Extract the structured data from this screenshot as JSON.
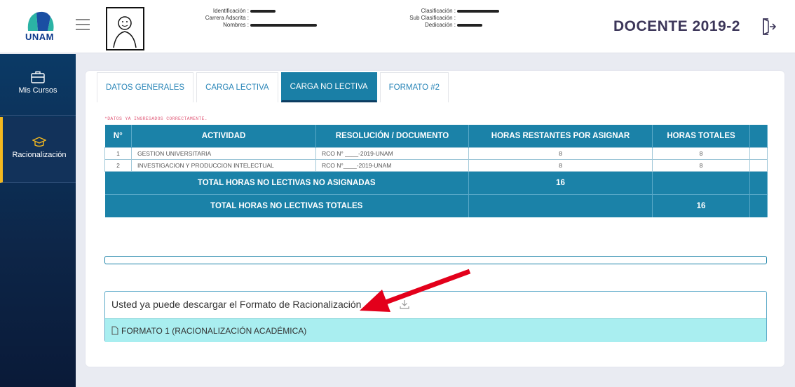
{
  "header": {
    "logo_text": "UNAM",
    "title": "DOCENTE 2019-2",
    "info_left": [
      {
        "label": "Identificación :"
      },
      {
        "label": "Carrera Adscrita :"
      },
      {
        "label": "Nombres :"
      }
    ],
    "info_right": [
      {
        "label": "Clasificación :"
      },
      {
        "label": "Sub Clasificación :"
      },
      {
        "label": "Dedicación :"
      }
    ]
  },
  "sidebar": {
    "items": [
      {
        "label": "Mis Cursos",
        "icon": "briefcase-icon"
      },
      {
        "label": "Racionalización",
        "icon": "graduation-cap-icon",
        "active": true
      }
    ]
  },
  "tabs": [
    {
      "label": "DATOS GENERALES"
    },
    {
      "label": "CARGA LECTIVA"
    },
    {
      "label": "CARGA NO LECTIVA",
      "active": true
    },
    {
      "label": "FORMATO #2"
    }
  ],
  "note": "*DATOS YA INGRESADOS CORRECTAMENTE.",
  "table": {
    "headers": [
      "N°",
      "ACTIVIDAD",
      "RESOLUCIÓN / DOCUMENTO",
      "HORAS RESTANTES POR ASIGNAR",
      "HORAS TOTALES"
    ],
    "rows": [
      {
        "n": "1",
        "actividad": "GESTION UNIVERSITARIA",
        "resolucion": "RCO N° ____-2019-UNAM",
        "restantes": "8",
        "totales": "8"
      },
      {
        "n": "2",
        "actividad": "INVESTIGACION Y PRODUCCION INTELECTUAL",
        "resolucion": "RCO N°____-2019-UNAM",
        "restantes": "8",
        "totales": "8"
      }
    ],
    "total_no_asignadas_label": "TOTAL HORAS NO LECTIVAS NO ASIGNADAS",
    "total_no_asignadas_value": "16",
    "total_totales_label": "TOTAL HORAS NO LECTIVAS TOTALES",
    "total_totales_value": "16"
  },
  "download": {
    "title": "Usted ya puede descargar el Formato de Racionalización",
    "item": "FORMATO 1 (RACIONALIZACIÓN ACADÉMICA)"
  },
  "colors": {
    "accent": "#1b82a8",
    "sidebar": "#0d2547",
    "highlight": "#a9eef0",
    "arrow": "#e3001b"
  }
}
